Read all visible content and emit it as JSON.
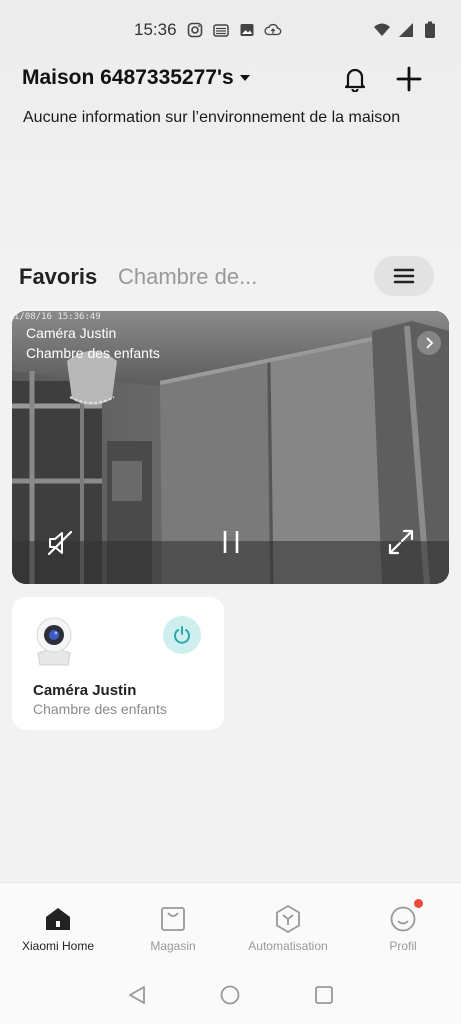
{
  "status_bar": {
    "time": "15:36",
    "icons_left": [
      "instagram-icon",
      "sim-icon",
      "image-icon",
      "cloud-upload-icon"
    ],
    "icons_right": [
      "wifi-icon",
      "signal-icon",
      "battery-icon"
    ]
  },
  "header": {
    "home_name": "Maison 6487335277's",
    "environment_text": "Aucune information sur l’environnement de la maison"
  },
  "tabs": {
    "active": "Favoris",
    "inactive": "Chambre de..."
  },
  "camera_preview": {
    "timestamp": "1/08/16 15:36:49",
    "name": "Caméra Justin",
    "room": "Chambre des enfants"
  },
  "device_card": {
    "name": "Caméra Justin",
    "room": "Chambre des enfants",
    "power_color": "#2aa8a8"
  },
  "bottom_nav": {
    "items": [
      {
        "label": "Xiaomi Home",
        "icon": "home-icon",
        "active": true
      },
      {
        "label": "Magasin",
        "icon": "shopping-bag-icon",
        "active": false
      },
      {
        "label": "Automatisation",
        "icon": "automation-icon",
        "active": false
      },
      {
        "label": "Profil",
        "icon": "profile-icon",
        "active": false
      }
    ]
  }
}
